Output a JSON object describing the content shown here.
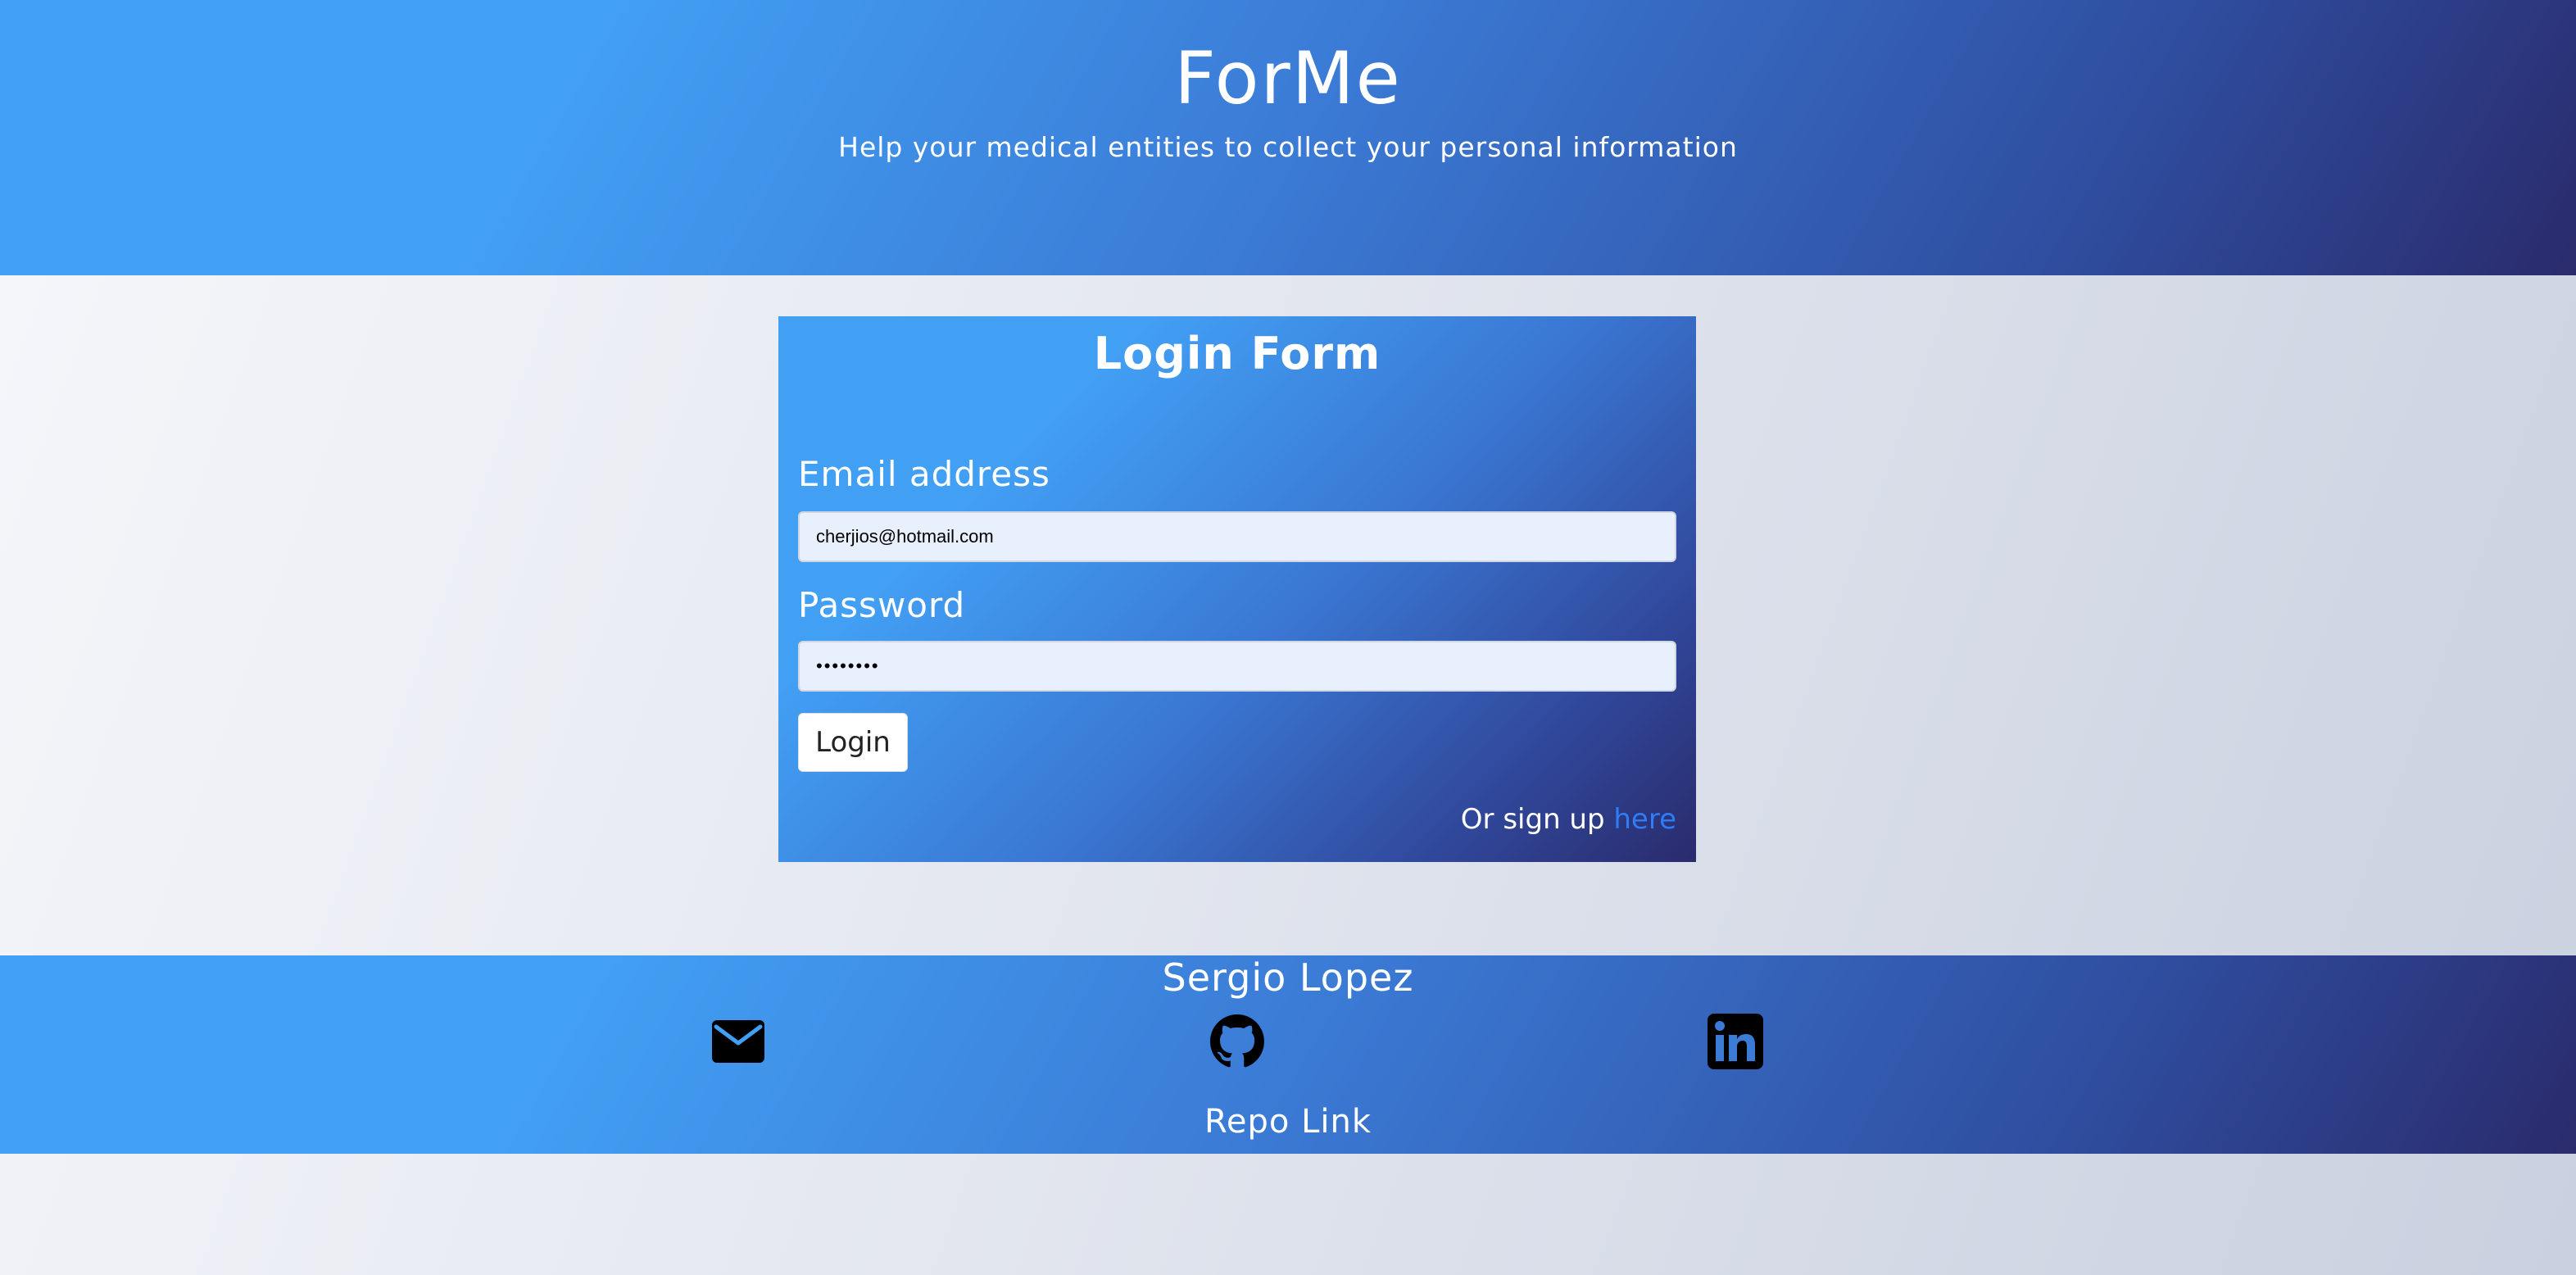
{
  "header": {
    "title": "ForMe",
    "subtitle": "Help your medical entities to collect your personal information"
  },
  "login_form": {
    "title": "Login Form",
    "email_label": "Email address",
    "email_value": "cherjios@hotmail.com",
    "password_label": "Password",
    "password_value": "••••••••",
    "login_button": "Login",
    "signup_text": "Or sign up ",
    "signup_link": "here"
  },
  "footer": {
    "name": "Sergio Lopez",
    "icons": [
      "mail-icon",
      "github-icon",
      "linkedin-icon"
    ],
    "repo_link": "Repo Link"
  },
  "colors": {
    "gradient_start": "#42a0f4",
    "gradient_end": "#2a2b6c",
    "link": "#2e7cf6",
    "input_bg": "#e8effd"
  }
}
